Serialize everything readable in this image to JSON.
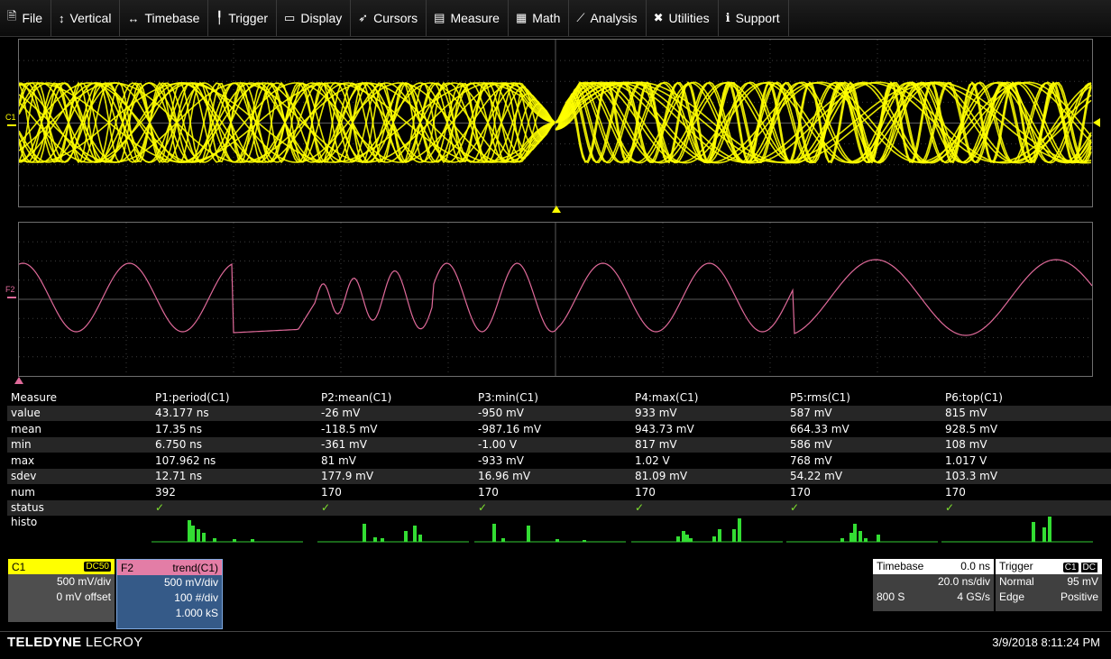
{
  "menu": [
    {
      "icon": "file-icon",
      "glyph": "🗎",
      "label": "File"
    },
    {
      "icon": "vertical-icon",
      "glyph": "↕",
      "label": "Vertical"
    },
    {
      "icon": "timebase-icon",
      "glyph": "↔",
      "label": "Timebase"
    },
    {
      "icon": "trigger-icon",
      "glyph": "╿",
      "label": "Trigger"
    },
    {
      "icon": "display-icon",
      "glyph": "▭",
      "label": "Display"
    },
    {
      "icon": "cursors-icon",
      "glyph": "➶",
      "label": "Cursors"
    },
    {
      "icon": "measure-icon",
      "glyph": "▤",
      "label": "Measure"
    },
    {
      "icon": "math-icon",
      "glyph": "▦",
      "label": "Math"
    },
    {
      "icon": "analysis-icon",
      "glyph": "⟋",
      "label": "Analysis"
    },
    {
      "icon": "utilities-icon",
      "glyph": "✖",
      "label": "Utilities"
    },
    {
      "icon": "support-icon",
      "glyph": "ℹ",
      "label": "Support"
    }
  ],
  "traces": {
    "c1": {
      "label": "C1",
      "color": "#ffff00"
    },
    "f2": {
      "label": "F2",
      "color": "#e06a9a"
    }
  },
  "measure": {
    "row_header": "Measure",
    "params": [
      "P1:period(C1)",
      "P2:mean(C1)",
      "P3:min(C1)",
      "P4:max(C1)",
      "P5:rms(C1)",
      "P6:top(C1)"
    ],
    "rows": [
      {
        "label": "value",
        "cells": [
          "43.177 ns",
          "-26 mV",
          "-950 mV",
          "933 mV",
          "587 mV",
          "815 mV"
        ]
      },
      {
        "label": "mean",
        "cells": [
          "17.35 ns",
          "-118.5 mV",
          "-987.16 mV",
          "943.73 mV",
          "664.33 mV",
          "928.5 mV"
        ]
      },
      {
        "label": "min",
        "cells": [
          "6.750 ns",
          "-361 mV",
          "-1.00 V",
          "817 mV",
          "586 mV",
          "108 mV"
        ]
      },
      {
        "label": "max",
        "cells": [
          "107.962 ns",
          "81 mV",
          "-933 mV",
          "1.02 V",
          "768 mV",
          "1.017 V"
        ]
      },
      {
        "label": "sdev",
        "cells": [
          "12.71 ns",
          "177.9 mV",
          "16.96 mV",
          "81.09 mV",
          "54.22 mV",
          "103.3 mV"
        ]
      },
      {
        "label": "num",
        "cells": [
          "392",
          "170",
          "170",
          "170",
          "170",
          "170"
        ]
      }
    ],
    "status_label": "status",
    "status_mark": "✓",
    "histo_label": "histo"
  },
  "c1box": {
    "label": "C1",
    "coupling": "DC50",
    "line1": "500 mV/div",
    "line2": "0 mV offset"
  },
  "f2box": {
    "label": "F2",
    "func": "trend(C1)",
    "line1": "500 mV/div",
    "line2": "100 #/div",
    "line3": "1.000 kS"
  },
  "timebase": {
    "title": "Timebase",
    "delay": "0.0 ns",
    "scale": "20.0 ns/div",
    "samples": "800 S",
    "rate": "4 GS/s"
  },
  "trigger": {
    "title": "Trigger",
    "source": "C1",
    "coupling": "DC",
    "mode": "Normal",
    "level": "95 mV",
    "type": "Edge",
    "slope": "Positive"
  },
  "brand": {
    "bold": "TELEDYNE",
    "light": "LECROY"
  },
  "datetime": "3/9/2018 8:11:24 PM"
}
